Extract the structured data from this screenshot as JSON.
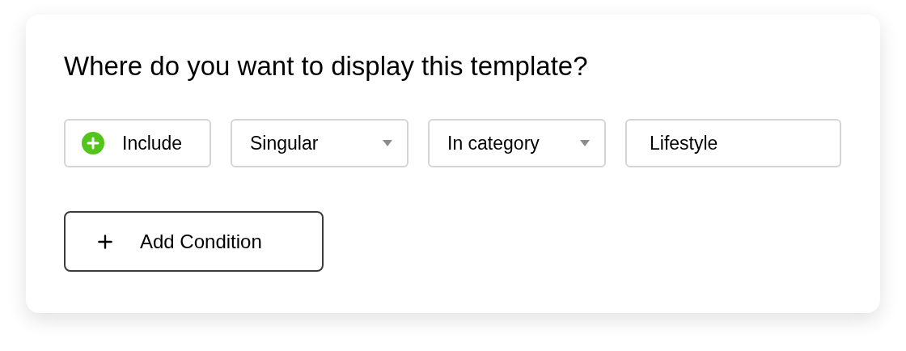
{
  "title": "Where do you want to display this template?",
  "condition": [
    {
      "kind": "toggle",
      "label": "Include"
    },
    {
      "kind": "select",
      "value": "Singular"
    },
    {
      "kind": "select",
      "value": "In category"
    },
    {
      "kind": "input",
      "value": "Lifestyle"
    }
  ],
  "add_button": {
    "label": "Add Condition"
  }
}
